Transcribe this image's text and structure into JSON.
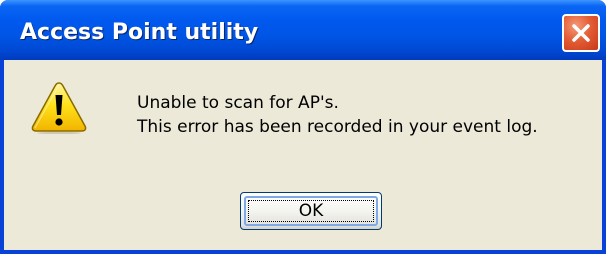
{
  "window": {
    "title": "Access Point utility",
    "close_icon": "close-icon"
  },
  "dialog": {
    "icon": "warning-icon",
    "message_line1": "Unable to scan for AP's.",
    "message_line2": "This error has been recorded in your event log.",
    "ok_label": "OK"
  },
  "colors": {
    "titlebar": "#0058ee",
    "window_border": "#0842d6",
    "body_background": "#ece9d8",
    "close_button": "#e35d35",
    "warning_yellow": "#ffd800"
  }
}
